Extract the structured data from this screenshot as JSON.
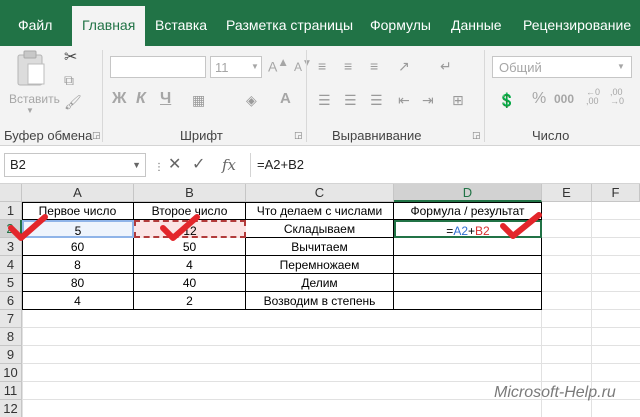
{
  "tabs": [
    "Файл",
    "Главная",
    "Вставка",
    "Разметка страницы",
    "Формулы",
    "Данные",
    "Рецензирование"
  ],
  "ribbon": {
    "paste_label": "Вставить",
    "font_size": "11",
    "number_format": "Общий",
    "bold": "Ж",
    "italic": "К",
    "underline": "Ч",
    "groups": [
      "Буфер обмена",
      "Шрифт",
      "Выравнивание",
      "Число"
    ]
  },
  "formula_bar": {
    "name_box": "B2",
    "cancel": "✕",
    "enter": "✓",
    "fx": "fx",
    "formula": "=A2+B2"
  },
  "columns": [
    "A",
    "B",
    "C",
    "D",
    "E",
    "F"
  ],
  "rows": [
    "1",
    "2",
    "3",
    "4",
    "5",
    "6",
    "7",
    "8",
    "9",
    "10",
    "11",
    "12"
  ],
  "table": {
    "headers": [
      "Первое число",
      "Второе число",
      "Что делаем с числами",
      "Формула / результат"
    ],
    "rows": [
      [
        "5",
        "12",
        "Складываем"
      ],
      [
        "60",
        "50",
        "Вычитаем"
      ],
      [
        "8",
        "4",
        "Перемножаем"
      ],
      [
        "80",
        "40",
        "Делим"
      ],
      [
        "4",
        "2",
        "Возводим в степень"
      ]
    ],
    "formula_parts": [
      "=",
      "A2",
      "+",
      "B2"
    ]
  },
  "watermark": "Microsoft-Help.ru"
}
